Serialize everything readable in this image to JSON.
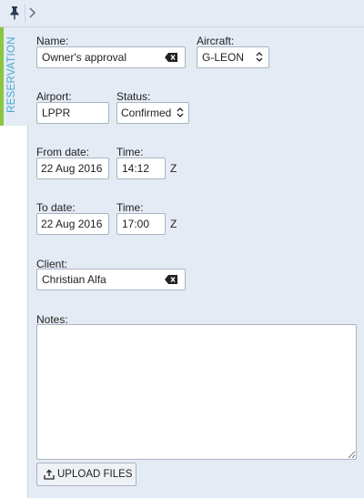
{
  "icons": {
    "pin": "pin-icon",
    "chevron": "chevron-right-icon",
    "clear": "backspace-clear-icon",
    "select": "updown-arrows-icon",
    "upload": "upload-icon"
  },
  "tabs": {
    "reservation": "RESERVATION"
  },
  "form": {
    "name": {
      "label": "Name:",
      "value": "Owner's approval"
    },
    "aircraft": {
      "label": "Aircraft:",
      "value": "G-LEON"
    },
    "airport": {
      "label": "Airport:",
      "value": "LPPR"
    },
    "status": {
      "label": "Status:",
      "value": "Confirmed"
    },
    "from_date": {
      "label": "From date:",
      "value": "22 Aug 2016"
    },
    "from_time": {
      "label": "Time:",
      "value": "14:12",
      "suffix": "Z"
    },
    "to_date": {
      "label": "To date:",
      "value": "22 Aug 2016"
    },
    "to_time": {
      "label": "Time:",
      "value": "17:00",
      "suffix": "Z"
    },
    "client": {
      "label": "Client:",
      "value": "Christian Alfa"
    },
    "notes": {
      "label": "Notes:",
      "value": ""
    },
    "upload_label": "UPLOAD FILES"
  },
  "colors": {
    "background": "#e5ebf4",
    "tab_accent": "#8cc63f",
    "tab_text": "#3fa9d6",
    "border": "#a9b4c2"
  }
}
